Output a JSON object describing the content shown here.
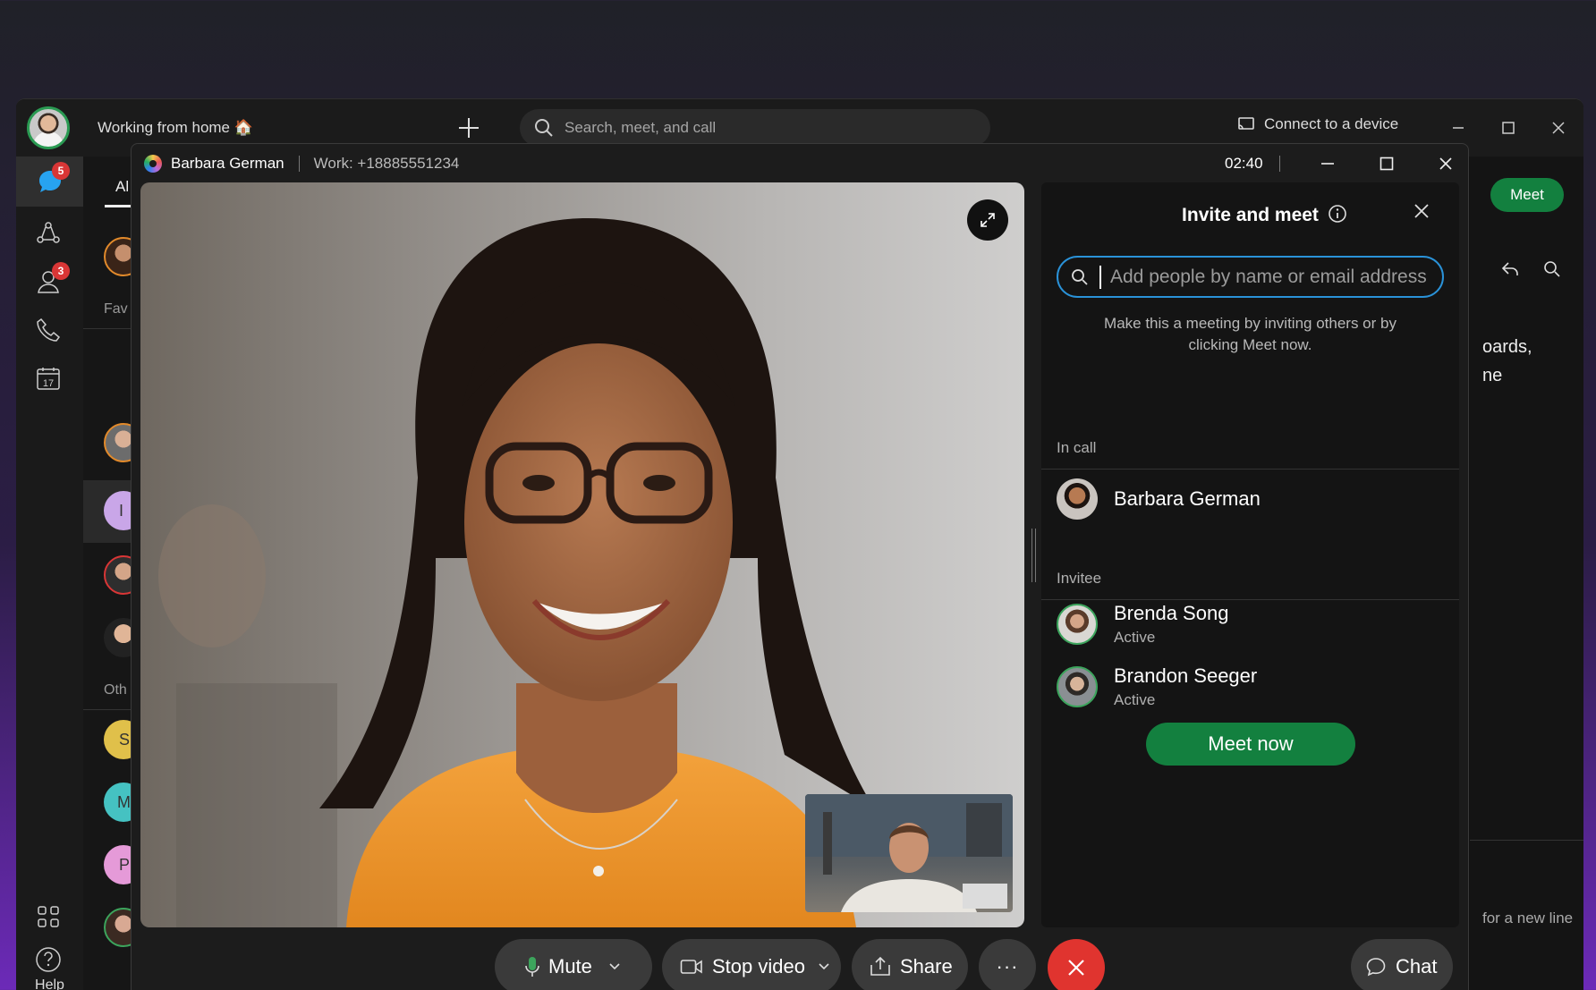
{
  "app": {
    "status_title": "Working from home 🏠",
    "search_placeholder": "Search, meet, and call",
    "connect_label": "Connect to a device",
    "meet_button": "Meet",
    "rail": {
      "messaging_badge": "5",
      "contacts_badge": "3",
      "calendar_day": "17",
      "help_label": "Help"
    },
    "list": {
      "tab_all": "Al",
      "section_favorites": "Fav",
      "section_others": "Oth",
      "initials": [
        "I",
        "S",
        "M",
        "P"
      ]
    },
    "right_fragments": {
      "line1": "oards,",
      "line2": "ne",
      "footer_hint": "for a new line"
    }
  },
  "call": {
    "caller_name": "Barbara German",
    "caller_number": "Work: +18885551234",
    "timer": "02:40",
    "invite_panel": {
      "title": "Invite and meet",
      "input_placeholder": "Add people by name or email address",
      "hint": "Make this a meeting by inviting others or by clicking Meet now.",
      "in_call_label": "In call",
      "invitee_label": "Invitee",
      "in_call": [
        {
          "name": "Barbara German"
        }
      ],
      "invitees": [
        {
          "name": "Brenda Song",
          "status": "Active"
        },
        {
          "name": "Brandon Seeger",
          "status": "Active"
        }
      ],
      "meet_now_label": "Meet now"
    },
    "controls": {
      "mute_label": "Mute",
      "stop_video_label": "Stop video",
      "share_label": "Share",
      "more_label": "···",
      "chat_label": "Chat"
    }
  },
  "colors": {
    "accent_green": "#13803f",
    "focus_blue": "#2a92d8",
    "end_call_red": "#e0342f",
    "badge_red": "#d93636"
  }
}
